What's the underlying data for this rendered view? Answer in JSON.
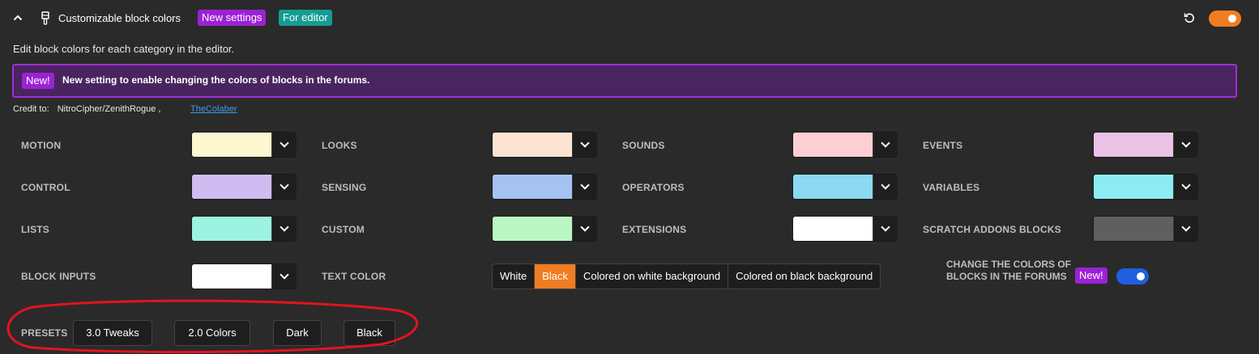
{
  "header": {
    "title": "Customizable block colors",
    "badges": [
      "New settings",
      "For editor"
    ],
    "enabled": true
  },
  "description": "Edit block colors for each category in the editor.",
  "notice": {
    "badge": "New!",
    "text": "New setting to enable changing the colors of blocks in the forums."
  },
  "credits": {
    "label": "Credit to:",
    "names": "NitroCipher/ZenithRogue ,",
    "link": "TheColaber"
  },
  "colors": [
    {
      "label": "MOTION",
      "color": "#fbf7cf"
    },
    {
      "label": "LOOKS",
      "color": "#fde4d2"
    },
    {
      "label": "SOUNDS",
      "color": "#fecfd2"
    },
    {
      "label": "EVENTS",
      "color": "#ecc2e6"
    },
    {
      "label": "CONTROL",
      "color": "#d0bcf1"
    },
    {
      "label": "SENSING",
      "color": "#a4c2f2"
    },
    {
      "label": "OPERATORS",
      "color": "#8bd9f2"
    },
    {
      "label": "VARIABLES",
      "color": "#8cecf4"
    },
    {
      "label": "LISTS",
      "color": "#9cf3e1"
    },
    {
      "label": "CUSTOM",
      "color": "#b9f6c2"
    },
    {
      "label": "EXTENSIONS",
      "color": "#ffffff"
    },
    {
      "label": "SCRATCH ADDONS BLOCKS",
      "color": "#5f5f5f"
    },
    {
      "label": "BLOCK INPUTS",
      "color": "#ffffff"
    }
  ],
  "text_color": {
    "label": "TEXT COLOR",
    "options": [
      "White",
      "Black",
      "Colored on white background",
      "Colored on black background"
    ],
    "selected": "Black"
  },
  "forums": {
    "label": "CHANGE THE COLORS OF BLOCKS IN THE FORUMS",
    "badge": "New!",
    "enabled": true
  },
  "presets": {
    "label": "PRESETS",
    "items": [
      "3.0 Tweaks",
      "2.0 Colors",
      "Dark",
      "Black"
    ]
  },
  "theme": {
    "accent_orange": "#f07d22",
    "accent_purple": "#9b22d4",
    "accent_teal": "#169c93",
    "toggle_blue": "#1f5fe0",
    "annotation_red": "#e0141e"
  },
  "icons": [
    "chevron-up-icon",
    "brush-icon",
    "reset-icon",
    "chevron-down-icon"
  ]
}
